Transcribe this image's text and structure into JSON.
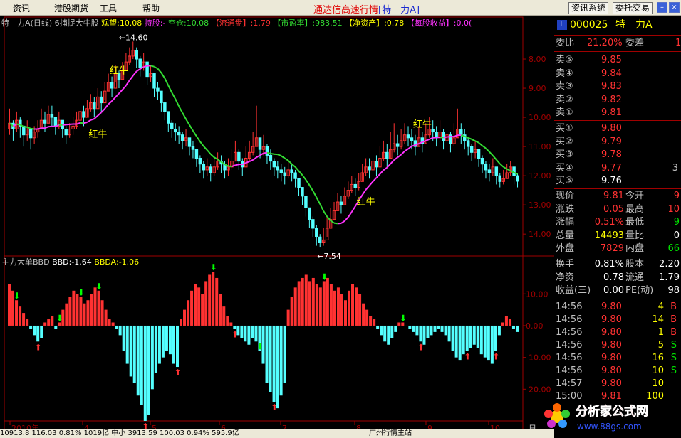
{
  "menu": [
    "资讯",
    "港股期货",
    "工具",
    "帮助"
  ],
  "app_title": {
    "main": "通达信高速行情",
    "bracket_open": "[",
    "stock": "特　力A",
    "bracket_close": "]"
  },
  "toolbar": {
    "info_system": "资讯系统",
    "entrust": "委托交易"
  },
  "window_icons": [
    "minimize-icon",
    "close-icon"
  ],
  "colors": {
    "up": "#ff3232",
    "down": "#54ffff",
    "ma_up": "#ff33ff",
    "ma_down": "#33dd33",
    "frame": "#a00000",
    "label": "#c0c0c0",
    "yellow": "#ffff00"
  },
  "main_header": {
    "name": "特　力A(日线)",
    "formula": "6捕捉大牛股",
    "items": [
      {
        "label": "观望:",
        "value": "10.08",
        "color": "#ffff00"
      },
      {
        "label": "持股:",
        "value": "-",
        "color": "#ff33ff"
      },
      {
        "label": "空仓:",
        "value": "10.08",
        "color": "#33dd33"
      },
      {
        "label": "【流通盘】",
        "value": ":1.79",
        "color": "#ff3232"
      },
      {
        "label": "【市盈率】",
        "value": ":983.51",
        "color": "#33dd33"
      },
      {
        "label": "【净资产】",
        "value": ":0.78",
        "color": "#ffff00"
      },
      {
        "label": "【每股收益】",
        "value": ":0.0(",
        "color": "#ff33ff"
      }
    ]
  },
  "sub_header": {
    "name": "主力大单BBD",
    "items": [
      {
        "label": "BBD:",
        "value": "-1.64",
        "color": "#ffffff"
      },
      {
        "label": "BBDA:",
        "value": "-1.06",
        "color": "#ffff00"
      }
    ]
  },
  "annotations": {
    "high": "14.60",
    "low": "7.54",
    "signal": "红牛"
  },
  "axis": {
    "price_ticks": [
      "14.00",
      "13.00",
      "12.00",
      "11.00",
      "10.00",
      "9.00",
      "8.00"
    ],
    "bbd_ticks": [
      "10.00",
      "0.00",
      "-10.00",
      "-20.00"
    ],
    "dates": [
      "2010年",
      "4",
      "5",
      "6",
      "7",
      "8",
      "9",
      "10"
    ],
    "corner": "日"
  },
  "chart_data": [
    {
      "type": "candlestick",
      "title": "特　力A(日线)",
      "ylim": [
        7.2,
        15.0
      ],
      "yticks": [
        8,
        9,
        10,
        11,
        12,
        13,
        14
      ],
      "x_categories": [
        "2010年",
        "4",
        "5",
        "6",
        "7",
        "8",
        "9",
        "10"
      ],
      "close": [
        11.8,
        11.6,
        11.9,
        11.7,
        11.4,
        11.6,
        11.3,
        11.5,
        11.6,
        11.9,
        11.8,
        12.1,
        12.0,
        11.7,
        11.9,
        11.6,
        11.4,
        11.6,
        11.7,
        11.9,
        12.2,
        12.0,
        12.3,
        12.5,
        12.3,
        12.7,
        12.5,
        12.9,
        13.2,
        13.0,
        13.5,
        13.3,
        13.6,
        13.9,
        14.1,
        14.3,
        14.0,
        13.7,
        13.9,
        13.4,
        13.5,
        13.0,
        12.9,
        12.5,
        12.2,
        11.8,
        11.6,
        11.5,
        11.4,
        11.2,
        11.3,
        11.0,
        10.9,
        10.6,
        10.4,
        10.2,
        10.3,
        10.1,
        10.3,
        10.5,
        10.4,
        10.2,
        10.3,
        10.5,
        10.8,
        10.5,
        10.3,
        10.6,
        10.8,
        11.0,
        11.3,
        10.9,
        11.0,
        10.7,
        10.5,
        10.3,
        10.2,
        10.1,
        10.0,
        10.2,
        10.1,
        9.9,
        9.6,
        9.3,
        8.9,
        8.5,
        8.2,
        7.9,
        7.7,
        7.8,
        8.2,
        8.5,
        8.8,
        9.1,
        9.0,
        9.3,
        9.5,
        9.7,
        9.6,
        9.8,
        10.1,
        10.3,
        10.2,
        10.5,
        10.3,
        10.6,
        10.8,
        10.6,
        10.9,
        11.1,
        11.0,
        11.2,
        11.4,
        11.3,
        11.2,
        11.0,
        11.3,
        11.1,
        11.4,
        11.6,
        11.5,
        11.3,
        11.5,
        11.2,
        11.4,
        11.1,
        11.3,
        11.6,
        11.4,
        11.2,
        11.0,
        10.8,
        10.9,
        10.6,
        10.4,
        10.2,
        10.1,
        10.3,
        10.0,
        9.8,
        9.9,
        10.1,
        10.3,
        10.0,
        9.81
      ],
      "high": [
        12.3,
        11.9,
        12.2,
        12.0,
        11.7,
        11.9,
        11.6,
        11.7,
        11.9,
        12.3,
        12.2,
        12.4,
        12.4,
        12.0,
        12.2,
        11.9,
        11.7,
        11.8,
        12.0,
        12.2,
        12.5,
        12.4,
        12.6,
        12.8,
        12.7,
        13.0,
        12.9,
        13.2,
        13.5,
        13.4,
        13.8,
        13.6,
        13.9,
        14.2,
        14.4,
        14.6,
        14.4,
        14.1,
        14.2,
        13.9,
        13.8,
        13.4,
        13.2,
        12.9,
        12.5,
        12.1,
        11.9,
        11.8,
        11.7,
        11.5,
        11.6,
        11.3,
        11.2,
        10.9,
        10.7,
        10.5,
        10.6,
        10.4,
        10.6,
        10.8,
        10.7,
        10.5,
        10.6,
        10.9,
        11.2,
        10.9,
        10.6,
        11.0,
        11.2,
        11.5,
        12.4,
        11.3,
        11.4,
        11.1,
        10.9,
        10.6,
        10.5,
        10.4,
        10.3,
        10.5,
        10.4,
        10.2,
        9.9,
        9.6,
        9.3,
        8.9,
        8.6,
        8.3,
        8.0,
        8.2,
        8.6,
        8.9,
        9.1,
        9.4,
        9.3,
        9.6,
        9.8,
        10.0,
        9.9,
        10.1,
        10.4,
        10.6,
        10.6,
        10.8,
        10.7,
        11.0,
        11.2,
        11.1,
        11.5,
        11.8,
        11.4,
        11.6,
        11.8,
        11.7,
        11.6,
        11.4,
        11.7,
        11.5,
        11.8,
        12.0,
        11.9,
        11.7,
        11.9,
        11.6,
        11.8,
        11.5,
        11.8,
        12.3,
        11.8,
        11.6,
        11.3,
        11.1,
        11.2,
        10.9,
        10.7,
        10.5,
        10.4,
        10.6,
        10.3,
        10.1,
        10.2,
        10.4,
        10.5,
        10.3,
        10.1
      ],
      "low": [
        11.4,
        11.2,
        11.5,
        11.3,
        11.0,
        11.2,
        10.9,
        11.1,
        11.3,
        11.6,
        11.5,
        11.8,
        11.7,
        11.4,
        11.6,
        11.3,
        11.1,
        11.3,
        11.4,
        11.6,
        11.9,
        11.7,
        12.0,
        12.2,
        12.0,
        12.4,
        12.2,
        12.6,
        12.9,
        12.7,
        13.2,
        13.0,
        13.3,
        13.6,
        13.8,
        14.0,
        13.7,
        13.4,
        13.6,
        13.1,
        13.2,
        12.7,
        12.6,
        12.2,
        11.9,
        11.5,
        11.3,
        11.2,
        11.1,
        10.9,
        11.0,
        10.7,
        10.6,
        10.3,
        10.1,
        9.9,
        10.0,
        9.8,
        10.0,
        10.2,
        10.1,
        9.9,
        10.0,
        10.2,
        10.5,
        10.2,
        10.0,
        10.3,
        10.5,
        10.7,
        11.0,
        10.6,
        10.7,
        10.4,
        10.2,
        10.0,
        9.9,
        9.8,
        9.7,
        9.9,
        9.8,
        9.6,
        9.3,
        9.0,
        8.6,
        8.2,
        7.9,
        7.6,
        7.54,
        7.6,
        7.9,
        8.2,
        8.5,
        8.8,
        8.7,
        9.0,
        9.2,
        9.4,
        9.3,
        9.5,
        9.8,
        10.0,
        9.9,
        10.2,
        10.0,
        10.3,
        10.5,
        10.3,
        10.6,
        10.8,
        10.7,
        10.9,
        11.1,
        11.0,
        10.9,
        10.7,
        11.0,
        10.8,
        11.1,
        11.3,
        11.2,
        11.0,
        11.2,
        10.9,
        11.1,
        10.8,
        11.0,
        11.3,
        11.1,
        10.9,
        10.7,
        10.5,
        10.6,
        10.3,
        10.1,
        9.9,
        9.8,
        10.0,
        9.7,
        9.6,
        9.7,
        9.9,
        10.0,
        9.7,
        9.6
      ],
      "high_label": "14.60",
      "low_label": "7.54"
    },
    {
      "type": "bar",
      "title": "主力大单BBD",
      "ylim": [
        -30,
        17
      ],
      "yticks": [
        10,
        0,
        -10,
        -20
      ],
      "values": [
        13,
        11,
        8,
        6,
        4,
        2,
        -1,
        -3,
        -5,
        -4,
        1,
        2,
        3,
        -1,
        1,
        5,
        7,
        9,
        11,
        10,
        9,
        7,
        8,
        10,
        12,
        11,
        8,
        5,
        2,
        1,
        -1,
        -3,
        -8,
        -12,
        -16,
        -18,
        -22,
        -25,
        -30,
        -28,
        -20,
        -15,
        -12,
        -10,
        -8,
        -9,
        -12,
        -13,
        2,
        5,
        8,
        11,
        13,
        12,
        10,
        14,
        16,
        17,
        15,
        10,
        6,
        3,
        1,
        -1,
        -3,
        -4,
        -5,
        -6,
        -4,
        -5,
        -8,
        -12,
        -18,
        -21,
        -24,
        -26,
        -22,
        -18,
        5,
        9,
        12,
        14,
        15,
        16,
        14,
        15,
        13,
        12,
        14,
        15,
        13,
        11,
        12,
        10,
        8,
        11,
        13,
        12,
        10,
        7,
        5,
        3,
        2,
        -1,
        -3,
        -5,
        -6,
        -4,
        -2,
        1,
        1,
        0,
        -1,
        -2,
        -3,
        -5,
        -6,
        -4,
        -3,
        -2,
        -1,
        -2,
        -3,
        -5,
        -8,
        -10,
        -11,
        -9,
        -8,
        -7,
        -6,
        -7,
        -9,
        -10,
        -11,
        -12,
        -8,
        -3,
        1,
        3,
        2,
        -1,
        -2
      ],
      "series": [
        {
          "name": "BBD",
          "last": "-1.64"
        },
        {
          "name": "BBDA",
          "last": "-1.06"
        }
      ]
    }
  ],
  "quote": {
    "code_badge": "L",
    "code": "000025",
    "name": "特　力A",
    "webi_label": "委比",
    "webi_value": "21.20%",
    "wecha_label": "委差",
    "wecha_value": "1",
    "sell": [
      {
        "label": "卖⑤",
        "price": "9.85",
        "vol": ""
      },
      {
        "label": "卖④",
        "price": "9.84",
        "vol": ""
      },
      {
        "label": "卖③",
        "price": "9.83",
        "vol": ""
      },
      {
        "label": "卖②",
        "price": "9.82",
        "vol": ""
      },
      {
        "label": "卖①",
        "price": "9.81",
        "vol": ""
      }
    ],
    "buy": [
      {
        "label": "买①",
        "price": "9.80",
        "vol": ""
      },
      {
        "label": "买②",
        "price": "9.79",
        "vol": ""
      },
      {
        "label": "买③",
        "price": "9.78",
        "vol": ""
      },
      {
        "label": "买④",
        "price": "9.77",
        "vol": "3"
      },
      {
        "label": "买⑤",
        "price": "9.76",
        "vol": ""
      }
    ],
    "stats": [
      {
        "l1": "现价",
        "v1": "9.81",
        "c1": "red",
        "l2": "今开",
        "v2": "9",
        "c2": "red"
      },
      {
        "l1": "涨跌",
        "v1": "0.05",
        "c1": "red",
        "l2": "最高",
        "v2": "10",
        "c2": "red"
      },
      {
        "l1": "涨幅",
        "v1": "0.51%",
        "c1": "red",
        "l2": "最低",
        "v2": "9",
        "c2": "grn"
      },
      {
        "l1": "总量",
        "v1": "14493",
        "c1": "yel",
        "l2": "量比",
        "v2": "0",
        "c2": "wht"
      },
      {
        "l1": "外盘",
        "v1": "7829",
        "c1": "red",
        "l2": "内盘",
        "v2": "66",
        "c2": "grn"
      }
    ],
    "fundamentals": [
      {
        "l1": "换手",
        "v1": "0.81%",
        "l2": "股本",
        "v2": "2.20"
      },
      {
        "l1": "净资",
        "v1": "0.78",
        "l2": "流通",
        "v2": "1.79"
      },
      {
        "l1": "收益(三)",
        "v1": "0.00",
        "l2": "PE(动)",
        "v2": "98"
      }
    ],
    "ticks": [
      {
        "time": "14:56",
        "price": "9.80",
        "vol": "4",
        "side": "B"
      },
      {
        "time": "14:56",
        "price": "9.80",
        "vol": "14",
        "side": "B"
      },
      {
        "time": "14:56",
        "price": "9.80",
        "vol": "1",
        "side": "B"
      },
      {
        "time": "14:56",
        "price": "9.80",
        "vol": "5",
        "side": "S"
      },
      {
        "time": "14:56",
        "price": "9.80",
        "vol": "16",
        "side": "S"
      },
      {
        "time": "14:56",
        "price": "9.80",
        "vol": "10",
        "side": "S"
      },
      {
        "time": "14:57",
        "price": "9.80",
        "vol": "10",
        "side": ""
      },
      {
        "time": "15:00",
        "price": "9.81",
        "vol": "100",
        "side": ""
      }
    ]
  },
  "status_bar": {
    "text": "10913.8  116.03  0.81%  1019亿  中小 3913.59  100.03  0.94%  595.9亿",
    "region": "广州行情主站"
  },
  "logo": {
    "text": "分析家公式网",
    "url": "www.88gs.com"
  }
}
